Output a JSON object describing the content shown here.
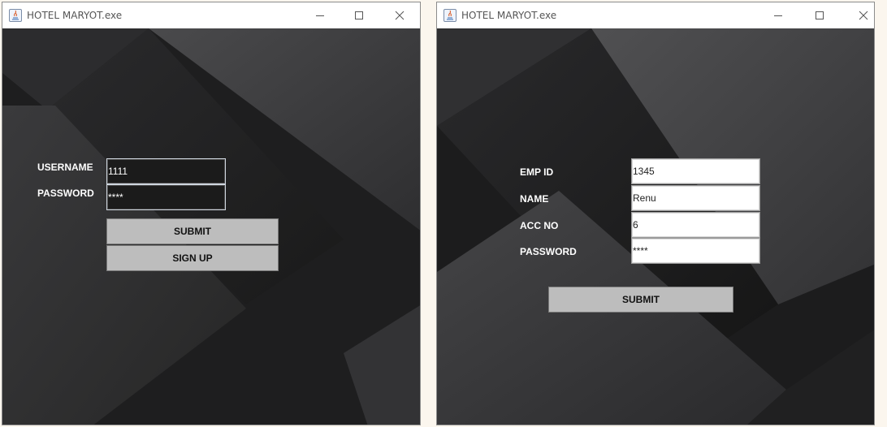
{
  "login_window": {
    "title": "HOTEL MARYOT.exe",
    "username_label": "USERNAME",
    "username_value": "1111",
    "password_label": "PASSWORD",
    "password_value": "****",
    "submit_label": "SUBMIT",
    "signup_label": "SIGN UP"
  },
  "employee_window": {
    "title": "HOTEL MARYOT.exe",
    "empid_label": "EMP ID",
    "empid_value": "1345",
    "name_label": "NAME",
    "name_value": "Renu",
    "accno_label": "ACC NO",
    "accno_value": "6",
    "password_label": "PASSWORD",
    "password_value": "****",
    "submit_label": "SUBMIT"
  },
  "icons": [
    "java-app-icon",
    "minimize-icon",
    "maximize-icon",
    "close-icon"
  ],
  "colors": {
    "background_dark": "#232323",
    "button_gray": "#bdbdbd",
    "titlebar": "#ffffff"
  }
}
